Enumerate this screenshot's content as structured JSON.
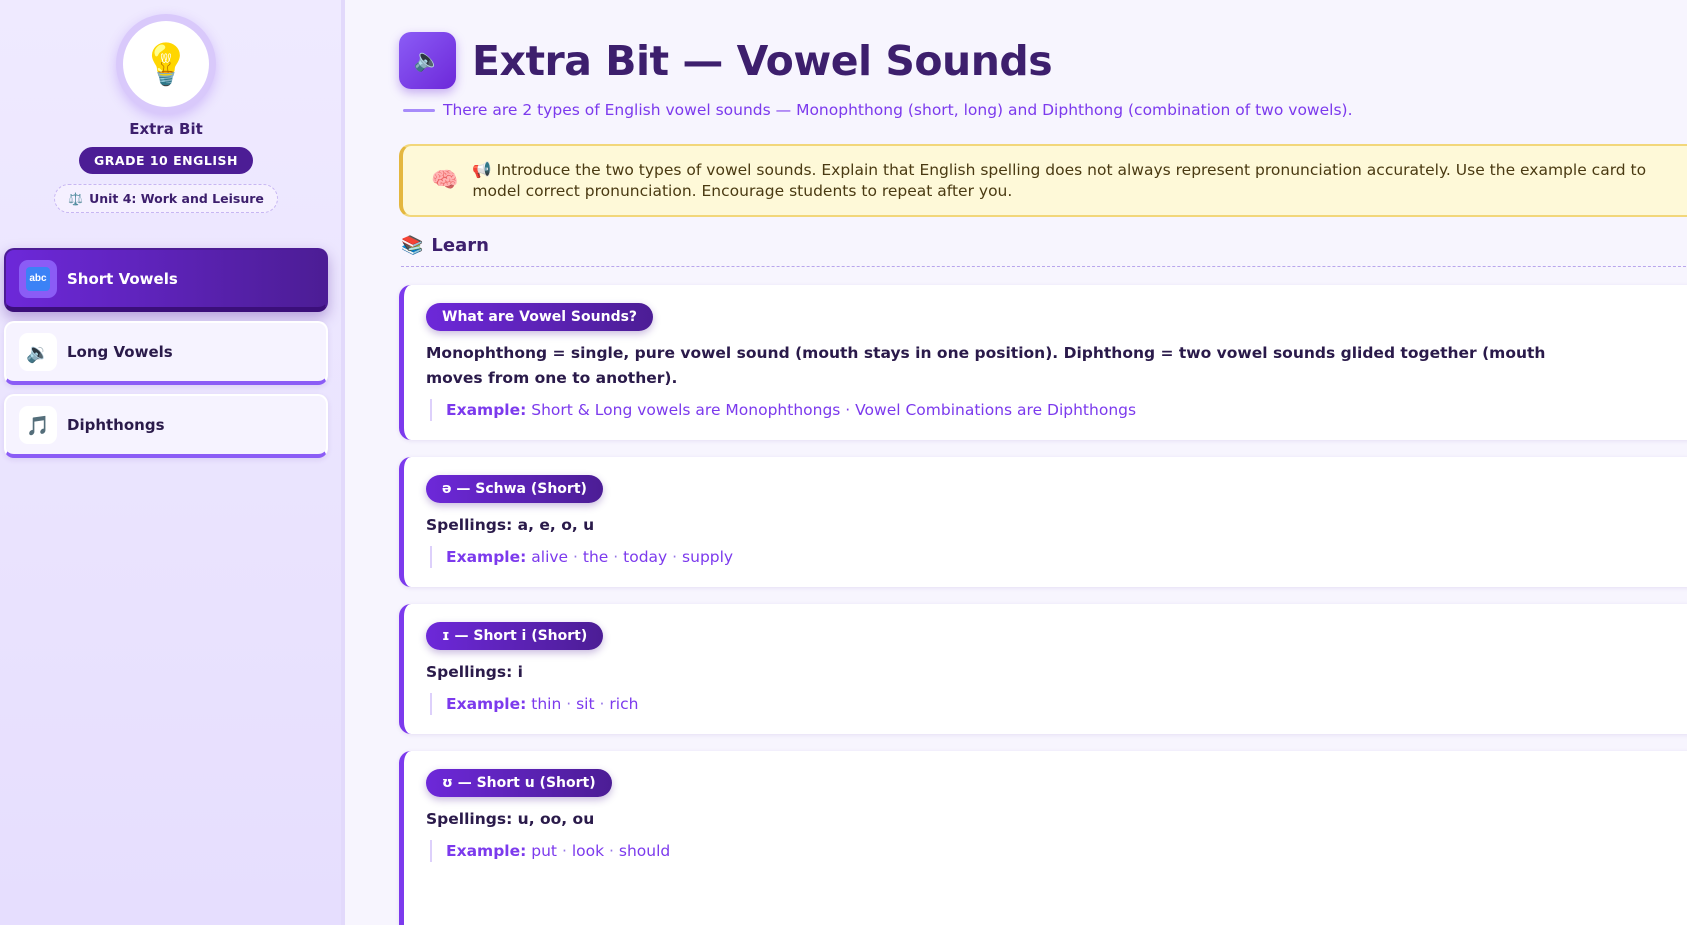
{
  "sidebar": {
    "brand_icon": "lightbulb-icon",
    "brand_name": "Extra Bit",
    "grade": "GRADE 10 ENGLISH",
    "unit_icon": "scales-icon",
    "unit": "Unit 4: Work and Leisure",
    "items": [
      {
        "label": "Short Vowels",
        "icon": "abc-icon",
        "active": true
      },
      {
        "label": "Long Vowels",
        "icon": "speaker-icon",
        "active": false
      },
      {
        "label": "Diphthongs",
        "icon": "music-note-icon",
        "active": false
      }
    ]
  },
  "header": {
    "icon": "speaker-icon",
    "title": "Extra Bit — Vowel Sounds",
    "subtitle": "There are 2 types of English vowel sounds — Monophthong (short, long) and Diphthong (combination of two vowels)."
  },
  "tip": {
    "icon": "brain-icon",
    "text": "📢 Introduce the two types of vowel sounds. Explain that English spelling does not always represent pronunciation accurately. Use the example card to model correct pronunciation. Encourage students to repeat after you."
  },
  "learn": {
    "icon": "books-icon",
    "label": "Learn"
  },
  "cards": [
    {
      "title": "What are Vowel Sounds?",
      "body": "Monophthong = single, pure vowel sound (mouth stays in one position). Diphthong = two vowel sounds glided together (mouth moves from one to another).",
      "example_label": "Example:",
      "example_text": "Short & Long vowels are Monophthongs · Vowel Combinations are Diphthongs"
    },
    {
      "title": "ə — Schwa (Short)",
      "body": "Spellings: a, e, o, u",
      "example_label": "Example:",
      "words": [
        "alive",
        "the",
        "today",
        "supply"
      ]
    },
    {
      "title": "ɪ — Short i (Short)",
      "body": "Spellings: i",
      "example_label": "Example:",
      "words": [
        "thin",
        "sit",
        "rich"
      ]
    },
    {
      "title": "ʊ — Short u (Short)",
      "body": "Spellings: u, oo, ou",
      "example_label": "Example:",
      "words": [
        "put",
        "look",
        "should"
      ]
    }
  ],
  "colors": {
    "accent": "#7c3aed",
    "accent_dark": "#4c1d95",
    "tip_bg": "#fef9d8",
    "tip_border": "#e4b73f"
  }
}
